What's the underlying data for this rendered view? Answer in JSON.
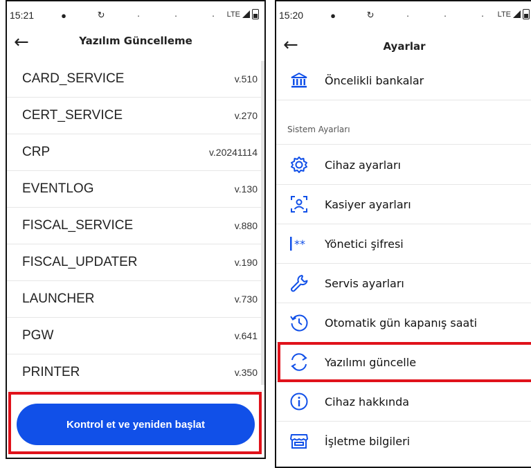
{
  "left_screen": {
    "status": {
      "time": "15:21",
      "network": "LTE"
    },
    "title": "Yazılım Güncelleme",
    "items": [
      {
        "name": "CARD_SERVICE",
        "version": "v.510"
      },
      {
        "name": "CERT_SERVICE",
        "version": "v.270"
      },
      {
        "name": "CRP",
        "version": "v.20241114"
      },
      {
        "name": "EVENTLOG",
        "version": "v.130"
      },
      {
        "name": "FISCAL_SERVICE",
        "version": "v.880"
      },
      {
        "name": "FISCAL_UPDATER",
        "version": "v.190"
      },
      {
        "name": "LAUNCHER",
        "version": "v.730"
      },
      {
        "name": "PGW",
        "version": "v.641"
      },
      {
        "name": "PRINTER",
        "version": "v.350"
      }
    ],
    "action_label": "Kontrol et ve yeniden başlat"
  },
  "right_screen": {
    "status": {
      "time": "15:20",
      "network": "LTE"
    },
    "title": "Ayarlar",
    "top_item": {
      "label": "Öncelikli bankalar",
      "icon": "bank-icon"
    },
    "section_label": "Sistem Ayarları",
    "items": [
      {
        "label": "Cihaz ayarları",
        "icon": "gear-icon"
      },
      {
        "label": "Kasiyer ayarları",
        "icon": "user-scan-icon"
      },
      {
        "label": "Yönetici şifresi",
        "icon": "password-icon"
      },
      {
        "label": "Servis ayarları",
        "icon": "wrench-icon"
      },
      {
        "label": "Otomatik gün kapanış saati",
        "icon": "clock-history-icon"
      },
      {
        "label": "Yazılımı güncelle",
        "icon": "sync-icon"
      },
      {
        "label": "Cihaz hakkında",
        "icon": "info-icon"
      },
      {
        "label": "İşletme bilgileri",
        "icon": "store-icon"
      }
    ]
  },
  "colors": {
    "accent": "#1150e8",
    "highlight": "#e0121b"
  }
}
